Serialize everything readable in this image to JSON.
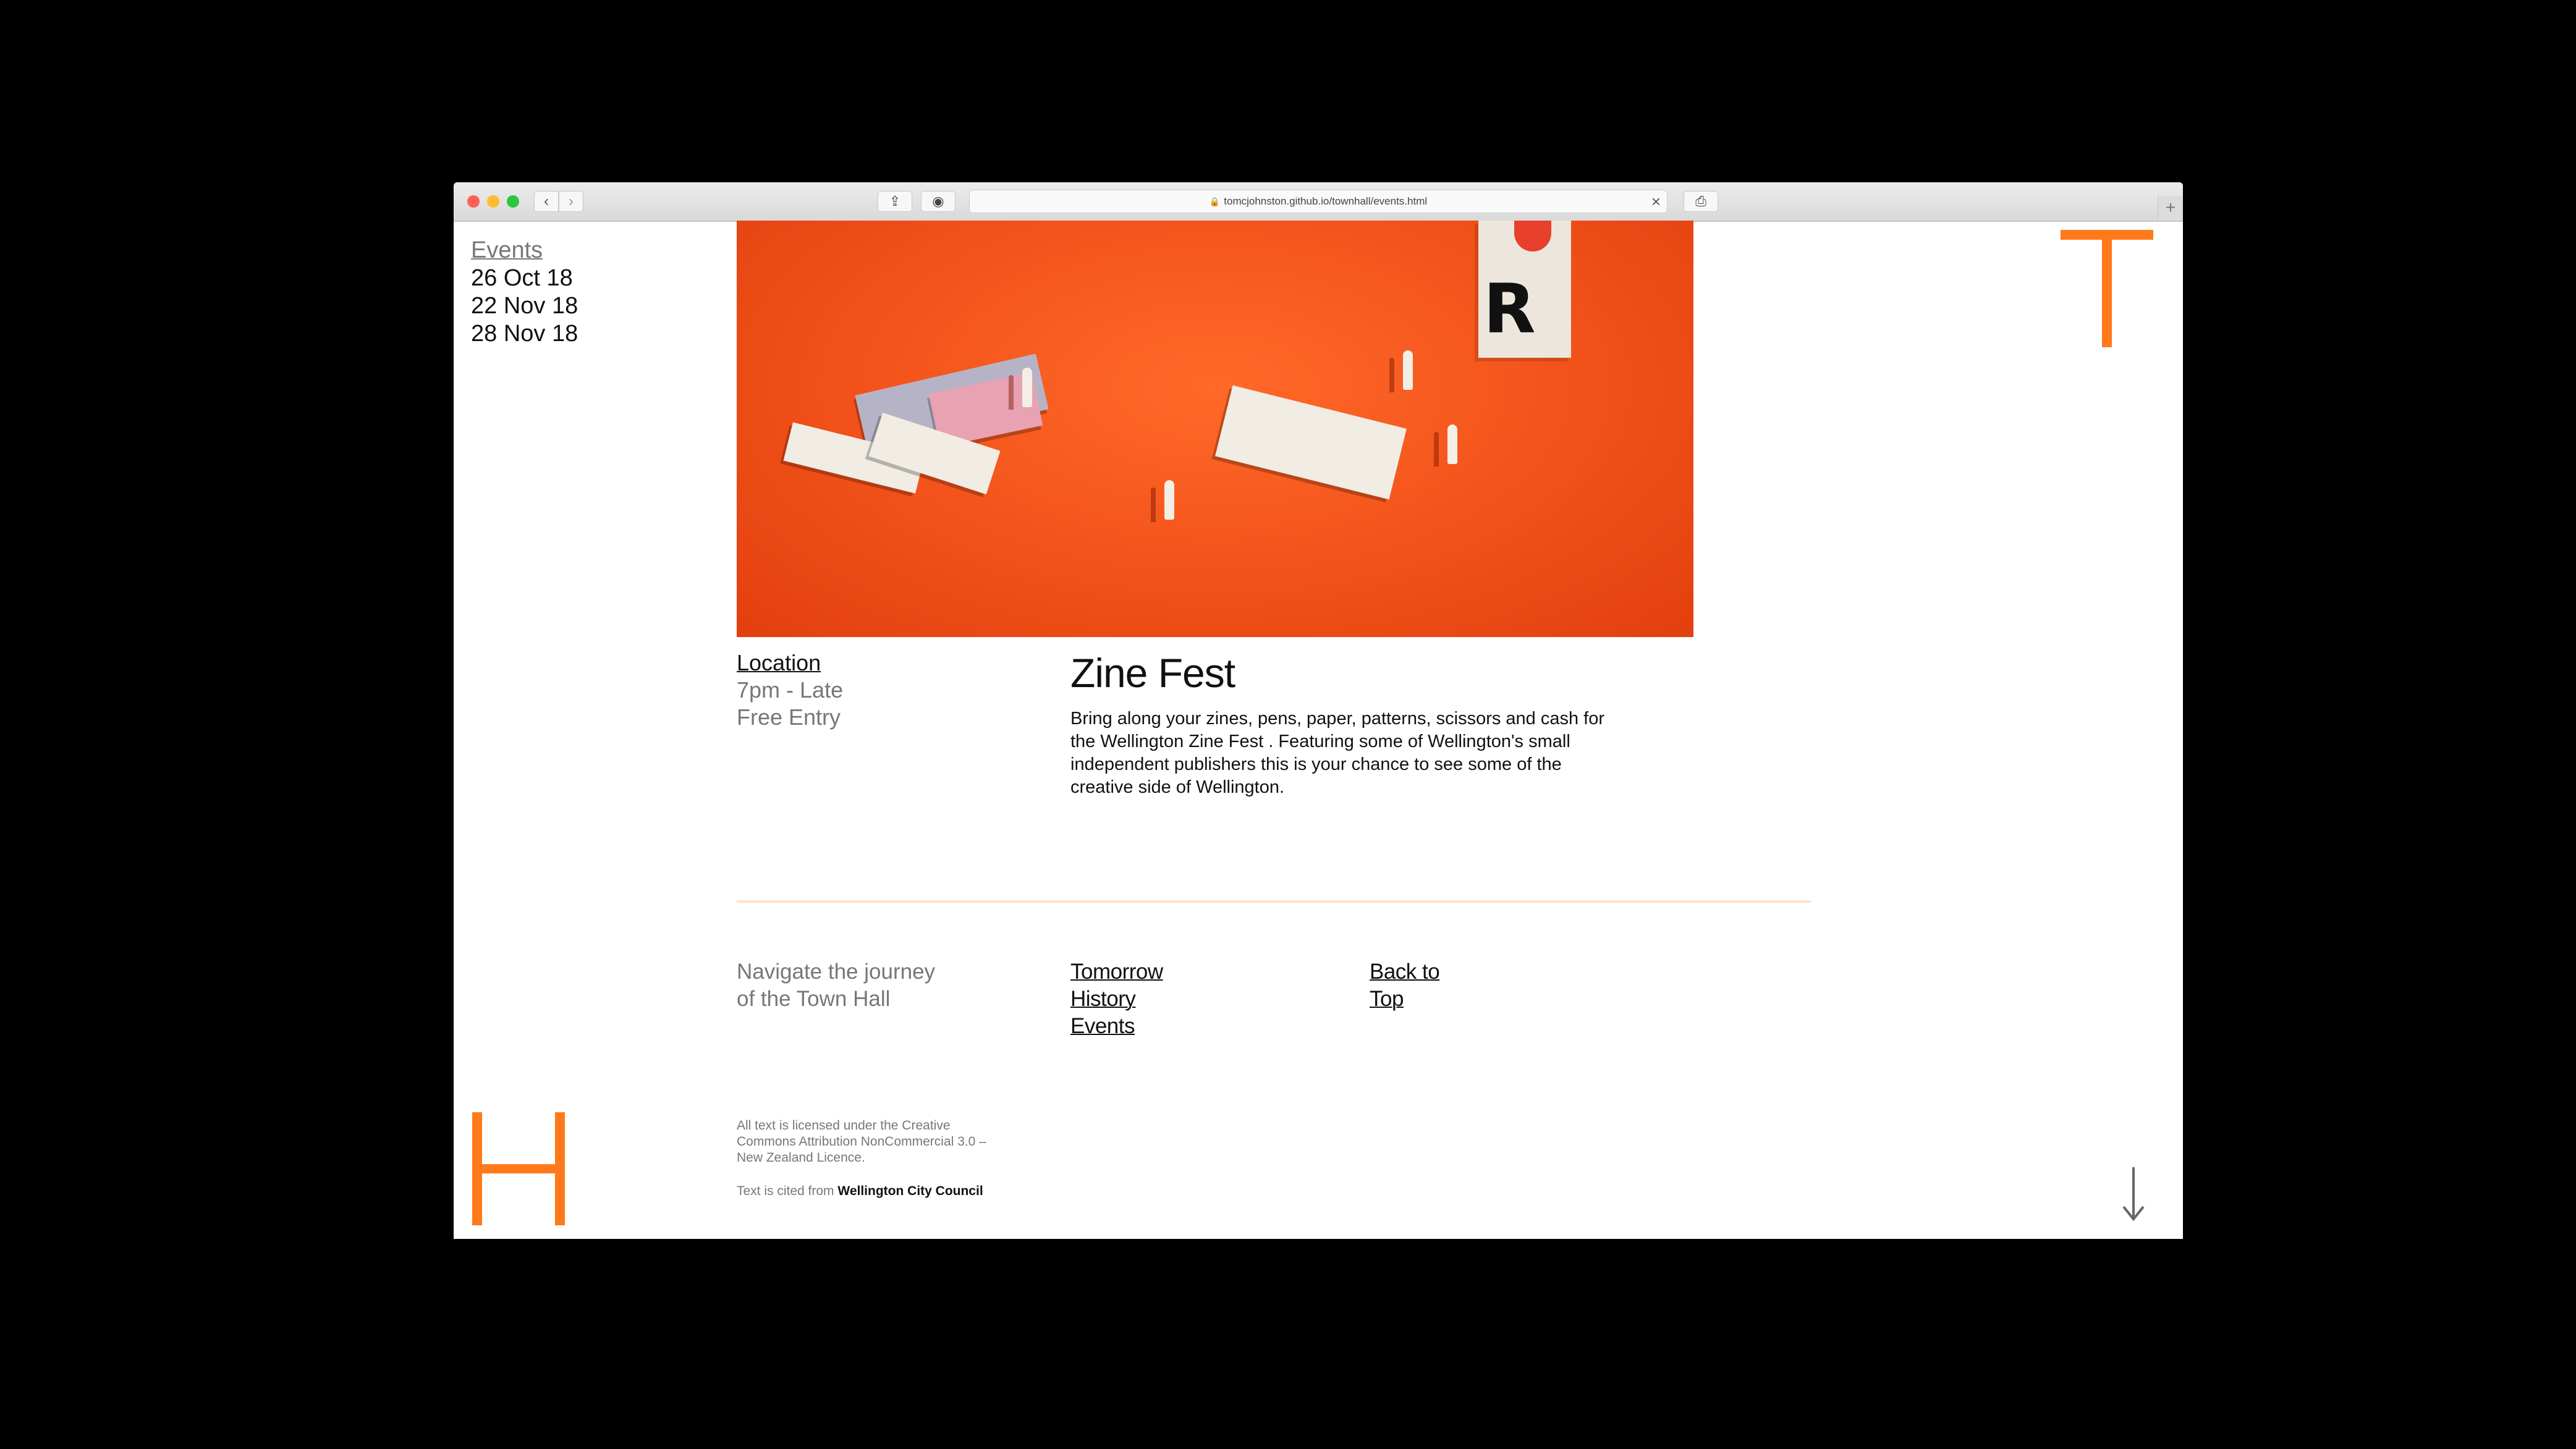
{
  "browser": {
    "url": "tomcjohnston.github.io/townhall/events.html",
    "icons": [
      "back-icon",
      "forward-icon",
      "share-icon",
      "reader-icon",
      "lock-icon",
      "close-icon",
      "print-icon",
      "plus-icon"
    ]
  },
  "events_nav": {
    "heading": "Events",
    "dates": [
      "26 Oct 18",
      "22 Nov 18",
      "28 Nov 18"
    ]
  },
  "brand": {
    "top_letter": "T",
    "bottom_letter": "H",
    "accent_color": "#ff7a1a"
  },
  "event": {
    "location_label": "Location",
    "time": "7pm - Late",
    "entry": "Free Entry",
    "title": "Zine Fest",
    "description": "Bring along your zines, pens, paper, patterns, scissors and cash for the Wellington Zine Fest . Featuring some of Wellington's small independent publishers this is your chance to see some of the creative side of Wellington."
  },
  "footer_nav": {
    "label_line1": "Navigate the journey",
    "label_line2": "of the Town Hall",
    "links": [
      "Tomorrow",
      "History",
      "Events"
    ],
    "back_to_top_line1": "Back to",
    "back_to_top_line2": "Top"
  },
  "legal": {
    "license": "All text is licensed under the Creative Commons Attribution NonCommercial 3.0 – New Zealand Licence.",
    "cited_prefix": "Text is cited from",
    "cited_source": "Wellington City Council"
  }
}
